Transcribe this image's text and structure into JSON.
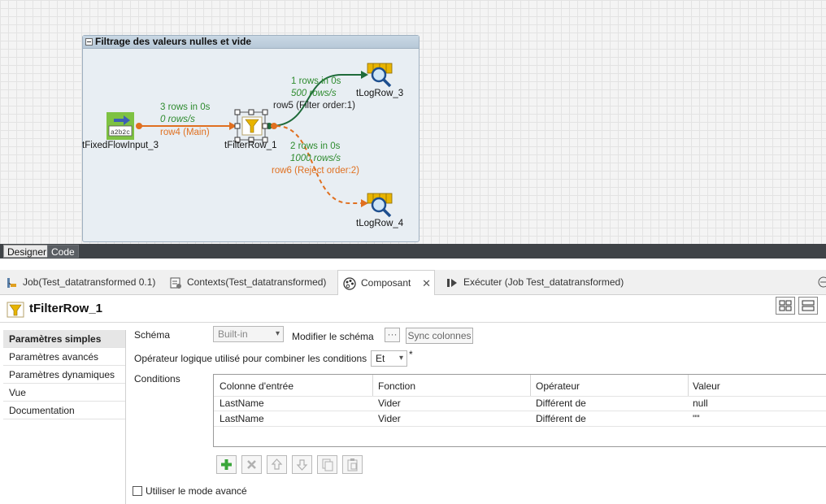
{
  "subjob": {
    "title": "Filtrage des valeurs nulles et vide"
  },
  "components": {
    "input": "tFixedFlowInput_3",
    "filter": "tFilterRow_1",
    "log3": "tLogRow_3",
    "log4": "tLogRow_4"
  },
  "flows": {
    "row4": {
      "rows": "3 rows in 0s",
      "rate": "0 rows/s",
      "name": "row4 (Main)"
    },
    "row5": {
      "rows": "1 rows in 0s",
      "rate": "500 rows/s",
      "name": "row5 (Filter order:1)"
    },
    "row6": {
      "rows": "2 rows in 0s",
      "rate": "1000 rows/s",
      "name": "row6 (Reject order:2)"
    }
  },
  "colors": {
    "main_flow": "#e07020",
    "filter_flow": "#1f6b3a",
    "stats_text": "#2e8b2e"
  },
  "view_tabs": {
    "designer": "Designer",
    "code": "Code"
  },
  "bottom_tabs": {
    "job": "Job(Test_datatransformed 0.1)",
    "contexts": "Contexts(Test_datatransformed)",
    "component": "Composant",
    "run": "Exécuter (Job Test_datatransformed)"
  },
  "panel": {
    "title": "tFilterRow_1"
  },
  "nav": [
    "Paramètres simples",
    "Paramètres avancés",
    "Paramètres dynamiques",
    "Vue",
    "Documentation"
  ],
  "form": {
    "schema_label": "Schéma",
    "schema_value": "Built-in",
    "edit_schema_label": "Modifier le schéma",
    "edit_schema_btn": "···",
    "sync_btn": "Sync colonnes",
    "logic_label": "Opérateur logique utilisé pour combiner les conditions",
    "logic_value": "Et",
    "required_mark": "*",
    "conditions_label": "Conditions",
    "advanced_label": "Utiliser le mode avancé"
  },
  "conditions": {
    "headers": [
      "Colonne d'entrée",
      "Fonction",
      "Opérateur",
      "Valeur"
    ],
    "rows": [
      [
        "LastName",
        "Vider",
        "Différent de",
        "null"
      ],
      [
        "LastName",
        "Vider",
        "Différent de",
        "\"\""
      ]
    ]
  }
}
